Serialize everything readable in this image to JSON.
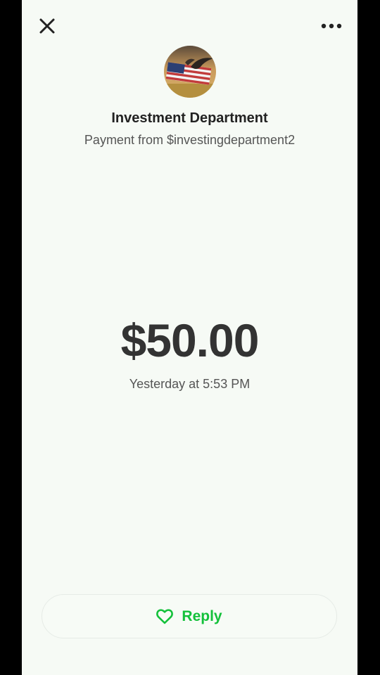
{
  "header": {
    "close_icon": "close-icon",
    "more_icon": "more-horizontal-icon"
  },
  "sender": {
    "name": "Investment Department",
    "subtitle": "Payment from $investingdepartment2",
    "avatar": "flag-eagle-avatar"
  },
  "payment": {
    "amount": "$50.00",
    "time": "Yesterday at 5:53 PM"
  },
  "reply": {
    "label": "Reply",
    "icon": "heart-icon",
    "color": "#14c13b"
  }
}
